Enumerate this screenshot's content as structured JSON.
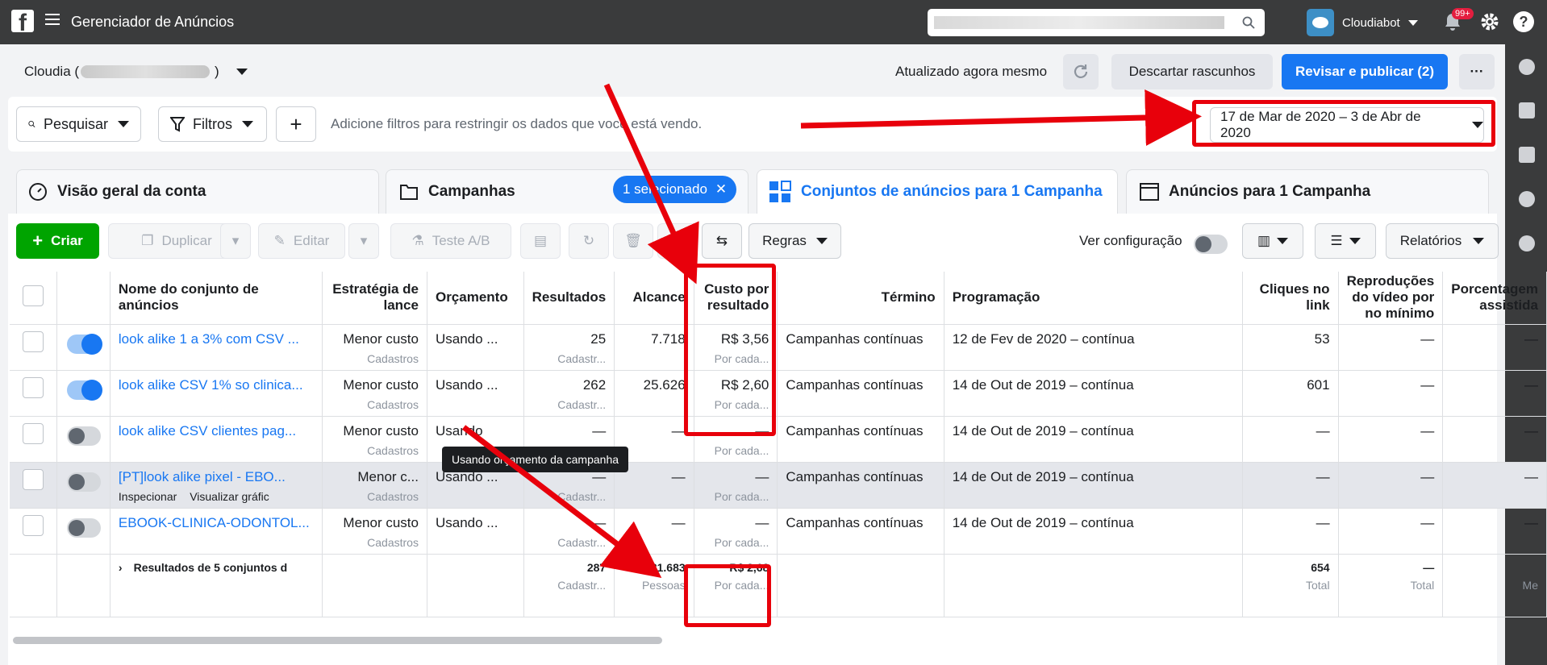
{
  "topbar": {
    "title": "Gerenciador de Anúncios",
    "account_name": "Cloudiabot",
    "notifications": "99+"
  },
  "header": {
    "account": "Cloudia (",
    "account_close": ")",
    "updated": "Atualizado agora mesmo",
    "discard": "Descartar rascunhos",
    "publish": "Revisar e publicar (2)",
    "more": "···"
  },
  "filters": {
    "search": "Pesquisar",
    "filters": "Filtros",
    "add": "+",
    "hint": "Adicione filtros para restringir os dados que você está vendo.",
    "date_range": "17 de Mar de 2020 – 3 de Abr de 2020"
  },
  "tabs": {
    "overview": "Visão geral da conta",
    "campaigns": "Campanhas",
    "selected": "1 selecionado",
    "adsets": "Conjuntos de anúncios para 1 Campanha",
    "ads": "Anúncios para 1 Campanha"
  },
  "toolbar": {
    "create": "Criar",
    "duplicate": "Duplicar",
    "edit": "Editar",
    "abtest": "Teste A/B",
    "rules": "Regras",
    "view_config": "Ver configuração",
    "reports": "Relatórios"
  },
  "columns": {
    "name": "Nome do conjunto de anúncios",
    "bid": "Estratégia de lance",
    "budget": "Orçamento",
    "results": "Resultados",
    "reach": "Alcance",
    "cost": "Custo por resultado",
    "end": "Término",
    "schedule": "Programação",
    "clicks": "Cliques no link",
    "video": "Reproduções do vídeo por no mínimo",
    "percent": "Porcentagem assistida"
  },
  "rows": [
    {
      "name": "look alike 1 a 3% com CSV ...",
      "bid": "Menor custo",
      "bid_sub": "Cadastros",
      "budget": "Usando ...",
      "results": "25",
      "results_sub": "Cadastr...",
      "reach": "7.718",
      "cost": "R$ 3,56",
      "cost_sub": "Por cada...",
      "end": "Campanhas contínuas",
      "schedule": "12 de Fev de 2020 – contínua",
      "clicks": "53",
      "video": "—",
      "percent": "—"
    },
    {
      "name": "look alike CSV 1% so clinica...",
      "bid": "Menor custo",
      "bid_sub": "Cadastros",
      "budget": "Usando ...",
      "results": "262",
      "results_sub": "Cadastr...",
      "reach": "25.626",
      "cost": "R$ 2,60",
      "cost_sub": "Por cada...",
      "end": "Campanhas contínuas",
      "schedule": "14 de Out de 2019 – contínua",
      "clicks": "601",
      "video": "—",
      "percent": "—"
    },
    {
      "name": "look alike CSV clientes pag...",
      "bid": "Menor custo",
      "bid_sub": "Cadastros",
      "budget": "Usando",
      "results": "—",
      "results_sub": "",
      "reach": "—",
      "cost": "—",
      "cost_sub": "Por cada...",
      "end": "Campanhas contínuas",
      "schedule": "14 de Out de 2019 – contínua",
      "clicks": "—",
      "video": "—",
      "percent": "—"
    },
    {
      "name": "[PT]look alike pixel - EBO...",
      "bid": "Menor c...",
      "bid_sub": "Cadastros",
      "budget": "Usando ...",
      "results": "—",
      "results_sub": "Cadastr...",
      "reach": "—",
      "cost": "—",
      "cost_sub": "Por cada...",
      "end": "Campanhas contínuas",
      "schedule": "14 de Out de 2019 – contínua",
      "clicks": "—",
      "video": "—",
      "percent": "—",
      "inspect": "Inspecionar",
      "chart": "Visualizar gráfic"
    },
    {
      "name": "EBOOK-CLINICA-ODONTOL...",
      "bid": "Menor custo",
      "bid_sub": "Cadastros",
      "budget": "Usando ...",
      "results": "—",
      "results_sub": "Cadastr...",
      "reach": "—",
      "cost": "—",
      "cost_sub": "Por cada...",
      "end": "Campanhas contínuas",
      "schedule": "14 de Out de 2019 – contínua",
      "clicks": "—",
      "video": "—",
      "percent": "—"
    }
  ],
  "totals": {
    "label": "Resultados de 5 conjuntos d",
    "results": "287",
    "results_sub": "Cadastr...",
    "reach": "31.683",
    "reach_sub": "Pessoas",
    "cost": "R$ 2,68",
    "cost_sub": "Por cada...",
    "clicks": "654",
    "clicks_sub": "Total",
    "video": "—",
    "video_sub": "Total",
    "percent_sub": "Me"
  },
  "tooltip": "Usando orçamento da campanha",
  "annotation_color": "#e8000b"
}
